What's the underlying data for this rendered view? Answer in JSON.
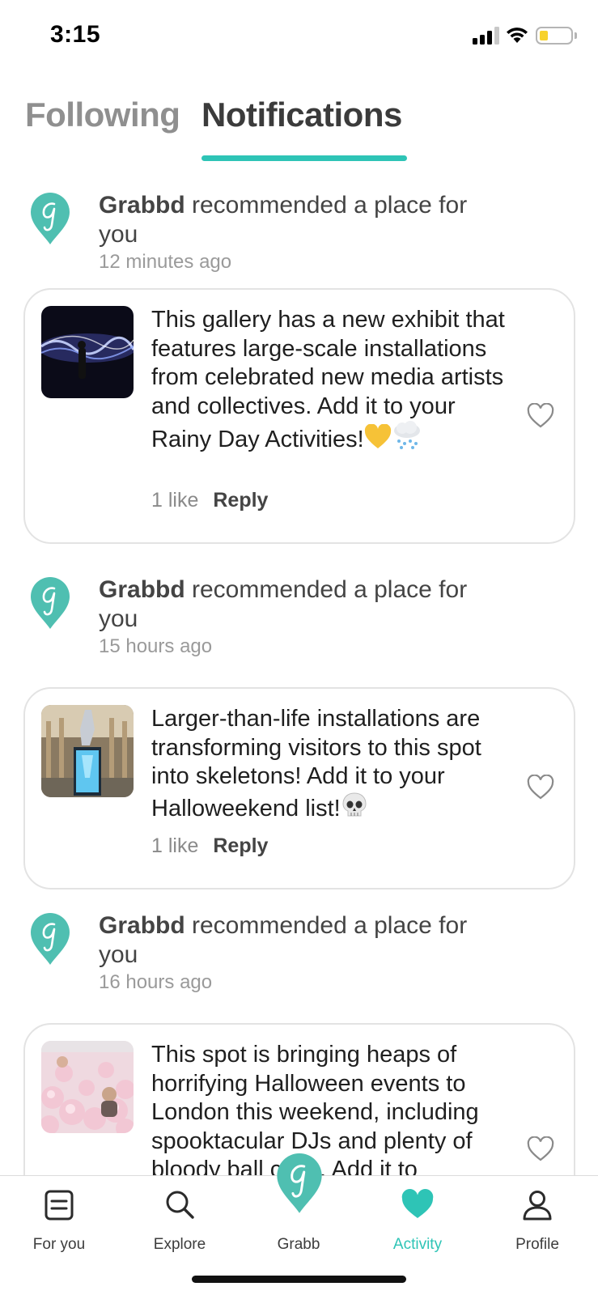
{
  "status_bar": {
    "time": "3:15"
  },
  "tabs": {
    "following": "Following",
    "notifications": "Notifications",
    "active": "notifications"
  },
  "notifications": [
    {
      "sender": "Grabbd",
      "action": " recommended a place for you",
      "time_ago": "12 minutes ago",
      "text": "This gallery has a new exhibit that features large-scale installations from celebrated new media artists and collectives. Add it to your Rainy Day Activities!",
      "emojis": [
        "yellow-heart",
        "rain-cloud"
      ],
      "likes": "1 like",
      "reply": "Reply"
    },
    {
      "sender": "Grabbd",
      "action": " recommended a place for you",
      "time_ago": "15 hours ago",
      "text": "Larger-than-life installations are transforming visitors to this spot into skeletons! Add it to your Halloweekend list!",
      "emojis": [
        "skull"
      ],
      "likes": "1 like",
      "reply": "Reply"
    },
    {
      "sender": "Grabbd",
      "action": " recommended a place for you",
      "time_ago": "16 hours ago",
      "text": "This spot is bringing heaps of horrifying Halloween events to London this weekend, including spooktacular DJs and plenty of bloody ball  ction. Add it to",
      "emojis": []
    }
  ],
  "bottom_nav": {
    "items": [
      {
        "label": "For you",
        "icon": "feed-icon"
      },
      {
        "label": "Explore",
        "icon": "search-icon"
      },
      {
        "label": "Grabb",
        "icon": "grabbd-logo-icon"
      },
      {
        "label": "Activity",
        "icon": "heart-icon"
      },
      {
        "label": "Profile",
        "icon": "profile-icon"
      }
    ],
    "active": "Activity"
  },
  "colors": {
    "accent": "#2ec4b6",
    "logo": "#4fbfb1",
    "text_muted": "#9a9a9a"
  }
}
